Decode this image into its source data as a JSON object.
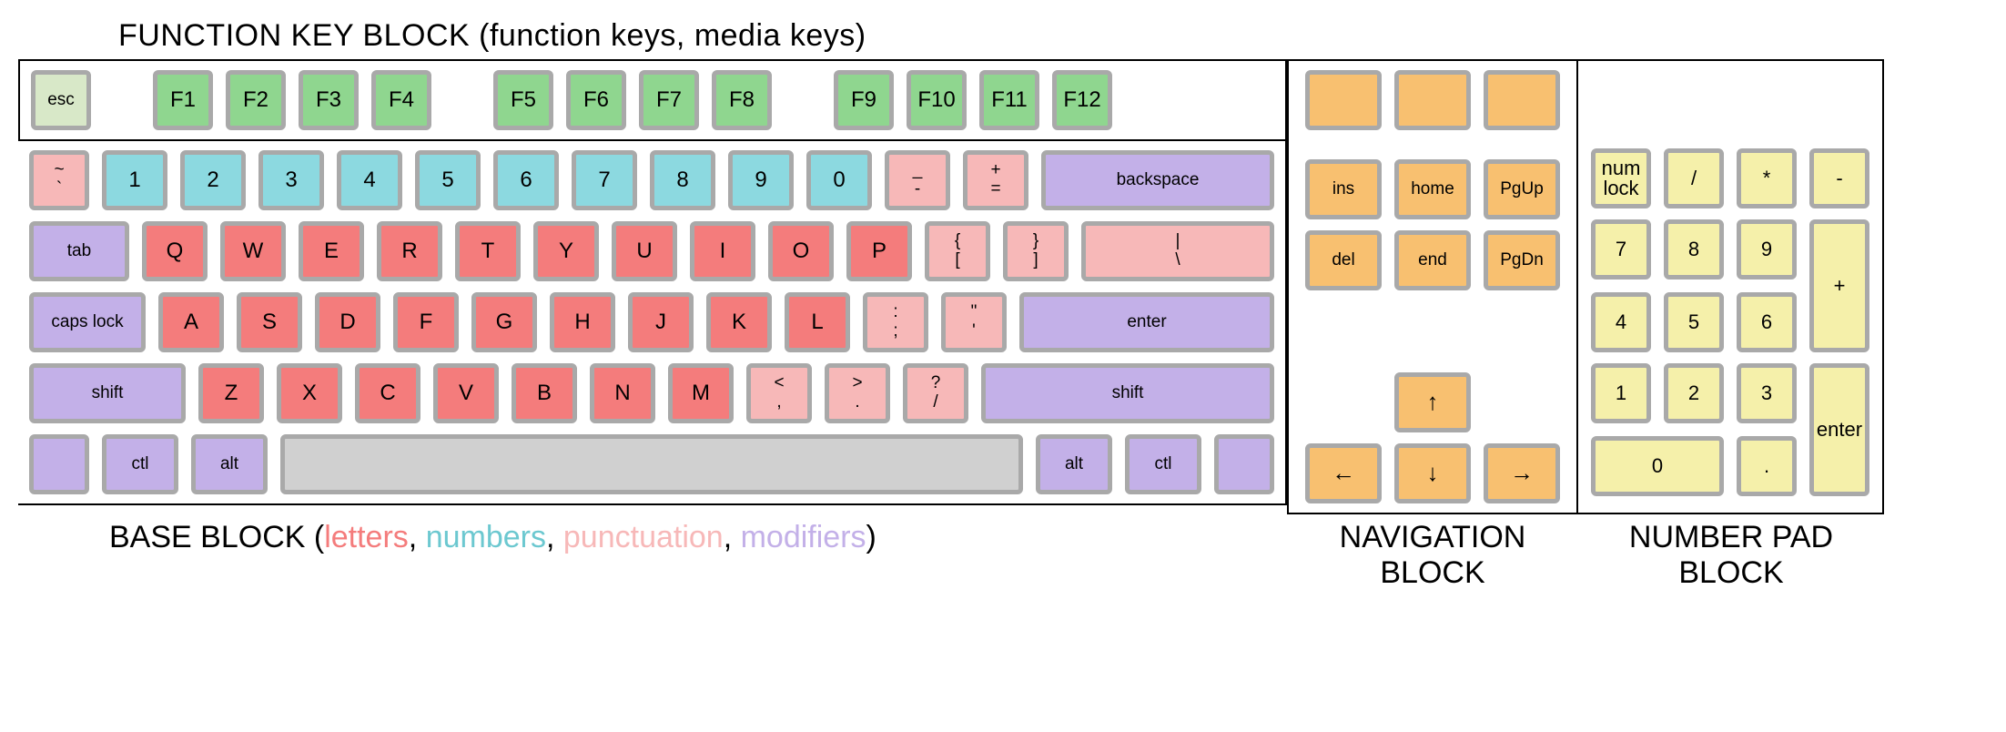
{
  "titles": {
    "top": "FUNCTION KEY BLOCK (function keys, media keys)",
    "base_prefix": "BASE BLOCK (",
    "base_letters": "letters",
    "base_numbers": "numbers",
    "base_punct": "punctuation",
    "base_mods": "modifiers",
    "base_suffix": ")",
    "nav": "NAVIGATION BLOCK",
    "np": "NUMBER PAD BLOCK",
    "sep": ", "
  },
  "func": {
    "esc": "esc",
    "f": [
      "F1",
      "F2",
      "F3",
      "F4",
      "F5",
      "F6",
      "F7",
      "F8",
      "F9",
      "F10",
      "F11",
      "F12"
    ]
  },
  "base": {
    "row1": {
      "tilde_top": "~",
      "tilde_bot": "`",
      "nums": [
        "1",
        "2",
        "3",
        "4",
        "5",
        "6",
        "7",
        "8",
        "9",
        "0"
      ],
      "dash_top": "_",
      "dash_bot": "-",
      "eq_top": "+",
      "eq_bot": "=",
      "backspace": "backspace"
    },
    "row2": {
      "tab": "tab",
      "letters": [
        "Q",
        "W",
        "E",
        "R",
        "T",
        "Y",
        "U",
        "I",
        "O",
        "P"
      ],
      "lb_top": "{",
      "lb_bot": "[",
      "rb_top": "}",
      "rb_bot": "]",
      "bs_top": "|",
      "bs_bot": "\\"
    },
    "row3": {
      "caps": "caps lock",
      "letters": [
        "A",
        "S",
        "D",
        "F",
        "G",
        "H",
        "J",
        "K",
        "L"
      ],
      "semi_top": ":",
      "semi_bot": ";",
      "quote_top": "\"",
      "quote_bot": "'",
      "enter": "enter"
    },
    "row4": {
      "lshift": "shift",
      "letters": [
        "Z",
        "X",
        "C",
        "V",
        "B",
        "N",
        "M"
      ],
      "comma_top": "<",
      "comma_bot": ",",
      "period_top": ">",
      "period_bot": ".",
      "slash_top": "?",
      "slash_bot": "/",
      "rshift": "shift"
    },
    "row5": {
      "lctl": "ctl",
      "lalt": "alt",
      "ralt": "alt",
      "rctl": "ctl"
    }
  },
  "nav": {
    "ins": "ins",
    "home": "home",
    "pgup": "PgUp",
    "del": "del",
    "end": "end",
    "pgdn": "PgDn",
    "up": "↑",
    "left": "←",
    "down": "↓",
    "right": "→"
  },
  "np": {
    "numlock": "num lock",
    "div": "/",
    "mul": "*",
    "sub": "-",
    "n7": "7",
    "n8": "8",
    "n9": "9",
    "add": "+",
    "n4": "4",
    "n5": "5",
    "n6": "6",
    "n1": "1",
    "n2": "2",
    "n3": "3",
    "enter": "enter",
    "n0": "0",
    "dot": "."
  }
}
